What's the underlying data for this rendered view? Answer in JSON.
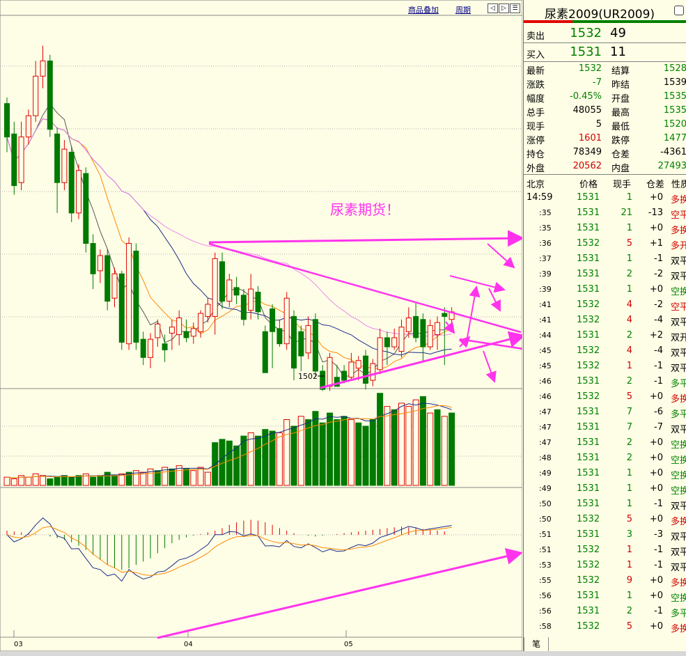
{
  "toolbar": {
    "overlay_label": "商品叠加",
    "period_label": "周期"
  },
  "chart_data": {
    "type": "candlestick",
    "price_annotation": {
      "label": "1502",
      "value": 1502
    },
    "annotation_text": "尿素期货！",
    "x_ticks": [
      "03",
      "04",
      "05"
    ],
    "price_ylim": [
      1485,
      1730
    ],
    "candles": [
      [
        1672,
        1650,
        1676,
        1640
      ],
      [
        1652,
        1618,
        1660,
        1612
      ],
      [
        1620,
        1650,
        1660,
        1615
      ],
      [
        1650,
        1664,
        1668,
        1645
      ],
      [
        1664,
        1690,
        1700,
        1660
      ],
      [
        1690,
        1700,
        1710,
        1682
      ],
      [
        1700,
        1655,
        1704,
        1650
      ],
      [
        1652,
        1620,
        1656,
        1600
      ],
      [
        1620,
        1642,
        1648,
        1615
      ],
      [
        1640,
        1600,
        1644,
        1594
      ],
      [
        1600,
        1628,
        1632,
        1596
      ],
      [
        1626,
        1580,
        1630,
        1574
      ],
      [
        1580,
        1560,
        1586,
        1550
      ],
      [
        1562,
        1572,
        1576,
        1554
      ],
      [
        1572,
        1542,
        1576,
        1536
      ],
      [
        1544,
        1560,
        1564,
        1538
      ],
      [
        1560,
        1515,
        1562,
        1510
      ],
      [
        1514,
        1580,
        1584,
        1510
      ],
      [
        1575,
        1515,
        1580,
        1510
      ],
      [
        1517,
        1505,
        1522,
        1500
      ],
      [
        1505,
        1517,
        1521,
        1498
      ],
      [
        1518,
        1527,
        1530,
        1512
      ],
      [
        1514,
        1510,
        1520,
        1502
      ],
      [
        1521,
        1525,
        1530,
        1510
      ],
      [
        1520,
        1531,
        1536,
        1513
      ],
      [
        1522,
        1518,
        1530,
        1515
      ],
      [
        1519,
        1524,
        1528,
        1514
      ],
      [
        1522,
        1534,
        1536,
        1518
      ],
      [
        1532,
        1540,
        1544,
        1528
      ],
      [
        1532,
        1570,
        1574,
        1520
      ],
      [
        1568,
        1542,
        1574,
        1537
      ],
      [
        1542,
        1556,
        1560,
        1538
      ],
      [
        1551,
        1546,
        1558,
        1540
      ],
      [
        1546,
        1530,
        1550,
        1526
      ],
      [
        1536,
        1550,
        1560,
        1530
      ],
      [
        1548,
        1535,
        1552,
        1530
      ],
      [
        1522,
        1495,
        1526,
        1498
      ],
      [
        1537,
        1522,
        1540,
        1498
      ],
      [
        1524,
        1514,
        1530,
        1512
      ],
      [
        1514,
        1544,
        1548,
        1510
      ],
      [
        1532,
        1498,
        1536,
        1490
      ],
      [
        1522,
        1506,
        1526,
        1496
      ],
      [
        1508,
        1526,
        1532,
        1504
      ],
      [
        1530,
        1496,
        1534,
        1492
      ],
      [
        1496,
        1484,
        1500,
        1483
      ],
      [
        1486,
        1505,
        1508,
        1483
      ],
      [
        1492,
        1486,
        1500,
        1486
      ],
      [
        1496,
        1490,
        1500,
        1488
      ],
      [
        1492,
        1502,
        1508,
        1490
      ],
      [
        1498,
        1503,
        1506,
        1490
      ],
      [
        1506,
        1488,
        1510,
        1484
      ],
      [
        1490,
        1501,
        1504,
        1486
      ],
      [
        1497,
        1518,
        1524,
        1494
      ],
      [
        1518,
        1512,
        1522,
        1500
      ],
      [
        1512,
        1518,
        1524,
        1510
      ],
      [
        1509,
        1525,
        1530,
        1505
      ],
      [
        1522,
        1531,
        1538,
        1518
      ],
      [
        1532,
        1518,
        1541,
        1515
      ],
      [
        1530,
        1512,
        1534,
        1502
      ],
      [
        1512,
        1526,
        1530,
        1510
      ],
      [
        1520,
        1528,
        1532,
        1510
      ],
      [
        1534,
        1532,
        1538,
        1500
      ],
      [
        1530,
        1535,
        1538,
        1525
      ]
    ],
    "volume": [
      [
        5,
        "u"
      ],
      [
        4,
        "u"
      ],
      [
        6,
        "u"
      ],
      [
        5,
        "u"
      ],
      [
        7,
        "u"
      ],
      [
        6,
        "u"
      ],
      [
        4,
        "d"
      ],
      [
        5,
        "d"
      ],
      [
        6,
        "d"
      ],
      [
        5,
        "d"
      ],
      [
        6,
        "d"
      ],
      [
        7,
        "u"
      ],
      [
        5,
        "d"
      ],
      [
        6,
        "d"
      ],
      [
        8,
        "d"
      ],
      [
        6,
        "d"
      ],
      [
        7,
        "u"
      ],
      [
        8,
        "d"
      ],
      [
        9,
        "u"
      ],
      [
        8,
        "u"
      ],
      [
        10,
        "u"
      ],
      [
        9,
        "d"
      ],
      [
        11,
        "u"
      ],
      [
        10,
        "d"
      ],
      [
        12,
        "u"
      ],
      [
        10,
        "d"
      ],
      [
        9,
        "u"
      ],
      [
        11,
        "u"
      ],
      [
        8,
        "u"
      ],
      [
        26,
        "d"
      ],
      [
        28,
        "d"
      ],
      [
        27,
        "d"
      ],
      [
        24,
        "d"
      ],
      [
        30,
        "d"
      ],
      [
        32,
        "u"
      ],
      [
        30,
        "d"
      ],
      [
        34,
        "d"
      ],
      [
        33,
        "d"
      ],
      [
        32,
        "u"
      ],
      [
        40,
        "u"
      ],
      [
        36,
        "d"
      ],
      [
        42,
        "u"
      ],
      [
        40,
        "d"
      ],
      [
        45,
        "d"
      ],
      [
        38,
        "d"
      ],
      [
        44,
        "d"
      ],
      [
        40,
        "d"
      ],
      [
        42,
        "d"
      ],
      [
        40,
        "u"
      ],
      [
        38,
        "d"
      ],
      [
        36,
        "d"
      ],
      [
        40,
        "d"
      ],
      [
        56,
        "d"
      ],
      [
        48,
        "u"
      ],
      [
        46,
        "d"
      ],
      [
        50,
        "u"
      ],
      [
        48,
        "u"
      ],
      [
        52,
        "u"
      ],
      [
        54,
        "d"
      ],
      [
        44,
        "u"
      ],
      [
        46,
        "d"
      ],
      [
        42,
        "u"
      ],
      [
        44,
        "d"
      ]
    ],
    "macd_bars": [
      5,
      4,
      3,
      2,
      1,
      0,
      -2,
      -4,
      -6,
      -9,
      -13,
      -18,
      -24,
      -30,
      -36,
      -40,
      -42,
      -40,
      -36,
      -32,
      -28,
      -22,
      -16,
      -10,
      -6,
      -3,
      -1,
      1,
      3,
      5,
      8,
      12,
      15,
      17,
      18,
      17,
      15,
      12,
      8,
      5,
      2,
      0,
      -1,
      -2,
      -1,
      0,
      1,
      2,
      3,
      4,
      5,
      6,
      7,
      8,
      9,
      10,
      9,
      8,
      7,
      6,
      5,
      4
    ],
    "annotations": [
      "尿素期货！"
    ]
  },
  "panel": {
    "title": "尿素2009(UR2009)",
    "sell": {
      "label": "卖出",
      "price": "1532",
      "vol": "49"
    },
    "buy": {
      "label": "买入",
      "price": "1531",
      "vol": "11"
    },
    "stats": [
      {
        "l1": "最新",
        "v1": "1532",
        "c1": "#008000",
        "l2": "结算",
        "v2": "1528",
        "c2": "#008000"
      },
      {
        "l1": "涨跌",
        "v1": "-7",
        "c1": "#008000",
        "l2": "昨结",
        "v2": "1539",
        "c2": "#000000"
      },
      {
        "l1": "幅度",
        "v1": "-0.45%",
        "c1": "#008000",
        "l2": "开盘",
        "v2": "1535",
        "c2": "#008000"
      },
      {
        "l1": "总手",
        "v1": "48055",
        "c1": "#000000",
        "l2": "最高",
        "v2": "1535",
        "c2": "#008000"
      },
      {
        "l1": "现手",
        "v1": "5",
        "c1": "#000000",
        "l2": "最低",
        "v2": "1520",
        "c2": "#008000"
      },
      {
        "l1": "涨停",
        "v1": "1601",
        "c1": "#d00000",
        "l2": "跌停",
        "v2": "1477",
        "c2": "#008000"
      },
      {
        "l1": "持仓",
        "v1": "78349",
        "c1": "#000000",
        "l2": "仓差",
        "v2": "-4361",
        "c2": "#000000"
      },
      {
        "l1": "外盘",
        "v1": "20562",
        "c1": "#d00000",
        "l2": "内盘",
        "v2": "27493",
        "c2": "#008000"
      }
    ],
    "trade_headers": {
      "time": "北京",
      "price": "价格",
      "vol": "现手",
      "diff": "仓差",
      "nature": "性质"
    },
    "trades": [
      {
        "time": "14:59",
        "price": "1531",
        "vol": "1",
        "diff": "+0",
        "nature": "多换"
      },
      {
        "time": ":35",
        "price": "1531",
        "vol": "21",
        "diff": "-13",
        "nature": "空平"
      },
      {
        "time": ":35",
        "price": "1531",
        "vol": "1",
        "diff": "+0",
        "nature": "多换"
      },
      {
        "time": ":36",
        "price": "1532",
        "vol": "5",
        "diff": "+1",
        "nature": "多开"
      },
      {
        "time": ":37",
        "price": "1531",
        "vol": "1",
        "diff": "-1",
        "nature": "双平"
      },
      {
        "time": ":39",
        "price": "1531",
        "vol": "2",
        "diff": "-2",
        "nature": "双平"
      },
      {
        "time": ":39",
        "price": "1531",
        "vol": "1",
        "diff": "+0",
        "nature": "空换"
      },
      {
        "time": ":41",
        "price": "1532",
        "vol": "4",
        "diff": "-2",
        "nature": "空平"
      },
      {
        "time": ":41",
        "price": "1532",
        "vol": "4",
        "diff": "-4",
        "nature": "双平"
      },
      {
        "time": ":44",
        "price": "1531",
        "vol": "2",
        "diff": "+2",
        "nature": "双开"
      },
      {
        "time": ":45",
        "price": "1532",
        "vol": "4",
        "diff": "-4",
        "nature": "双平"
      },
      {
        "time": ":45",
        "price": "1532",
        "vol": "1",
        "diff": "-1",
        "nature": "双平"
      },
      {
        "time": ":46",
        "price": "1531",
        "vol": "2",
        "diff": "-1",
        "nature": "多平"
      },
      {
        "time": ":46",
        "price": "1532",
        "vol": "5",
        "diff": "+0",
        "nature": "多换"
      },
      {
        "time": ":47",
        "price": "1531",
        "vol": "7",
        "diff": "-6",
        "nature": "多平"
      },
      {
        "time": ":47",
        "price": "1531",
        "vol": "7",
        "diff": "-7",
        "nature": "双平"
      },
      {
        "time": ":47",
        "price": "1531",
        "vol": "2",
        "diff": "+0",
        "nature": "空换"
      },
      {
        "time": ":48",
        "price": "1531",
        "vol": "2",
        "diff": "+0",
        "nature": "空换"
      },
      {
        "time": ":49",
        "price": "1531",
        "vol": "1",
        "diff": "+0",
        "nature": "空换"
      },
      {
        "time": ":49",
        "price": "1531",
        "vol": "1",
        "diff": "+0",
        "nature": "空换"
      },
      {
        "time": ":50",
        "price": "1531",
        "vol": "1",
        "diff": "-1",
        "nature": "双平"
      },
      {
        "time": ":50",
        "price": "1532",
        "vol": "5",
        "diff": "+0",
        "nature": "多换"
      },
      {
        "time": ":51",
        "price": "1531",
        "vol": "3",
        "diff": "-3",
        "nature": "双平"
      },
      {
        "time": ":51",
        "price": "1532",
        "vol": "1",
        "diff": "-1",
        "nature": "双平"
      },
      {
        "time": ":53",
        "price": "1532",
        "vol": "1",
        "diff": "-1",
        "nature": "双平"
      },
      {
        "time": ":55",
        "price": "1532",
        "vol": "9",
        "diff": "+0",
        "nature": "多换"
      },
      {
        "time": ":56",
        "price": "1531",
        "vol": "1",
        "diff": "+0",
        "nature": "空换"
      },
      {
        "time": ":56",
        "price": "1531",
        "vol": "2",
        "diff": "-1",
        "nature": "多平"
      },
      {
        "time": ":58",
        "price": "1532",
        "vol": "5",
        "diff": "+0",
        "nature": "多换"
      }
    ],
    "bottom_tab": "笔"
  },
  "colors": {
    "up": "#e00000",
    "down": "#007a00",
    "annotation": "#ff33ee",
    "background": "#fefee6"
  }
}
